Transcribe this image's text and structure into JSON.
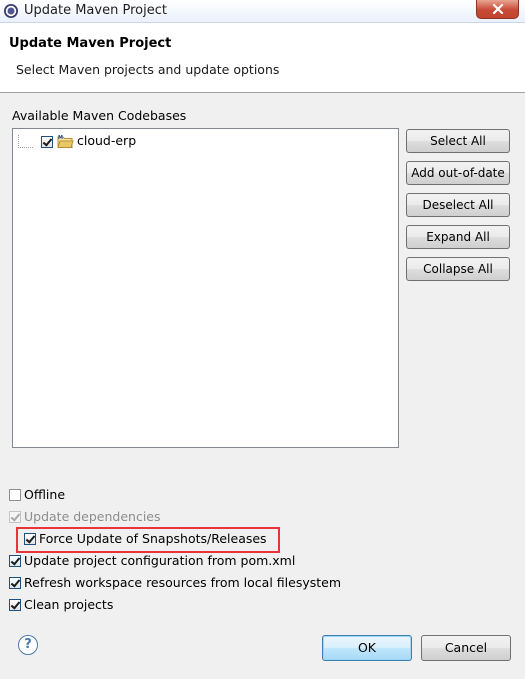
{
  "window": {
    "title": "Update Maven Project",
    "close_label": "✕"
  },
  "header": {
    "title": "Update Maven Project",
    "subtitle": "Select Maven projects and update options"
  },
  "codebases": {
    "label": "Available Maven Codebases",
    "items": [
      {
        "label": "cloud-erp",
        "checked": true,
        "icon": "maven-folder-icon"
      }
    ]
  },
  "side_buttons": {
    "select_all": "Select All",
    "add_out_of_date": "Add out-of-date",
    "deselect_all": "Deselect All",
    "expand_all": "Expand All",
    "collapse_all": "Collapse All"
  },
  "options": {
    "offline": {
      "label": "Offline",
      "checked": false
    },
    "update_dependencies": {
      "label": "Update dependencies",
      "checked": true,
      "enabled": false
    },
    "force_update": {
      "label": "Force Update of Snapshots/Releases",
      "checked": true
    },
    "update_config": {
      "label": "Update project configuration from pom.xml",
      "checked": true
    },
    "refresh_workspace": {
      "label": "Refresh workspace resources from local filesystem",
      "checked": true
    },
    "clean_projects": {
      "label": "Clean projects",
      "checked": true
    }
  },
  "footer": {
    "help": "?",
    "ok": "OK",
    "cancel": "Cancel"
  },
  "colors": {
    "highlight": "#e8353b",
    "accent": "#3c7fb1"
  }
}
